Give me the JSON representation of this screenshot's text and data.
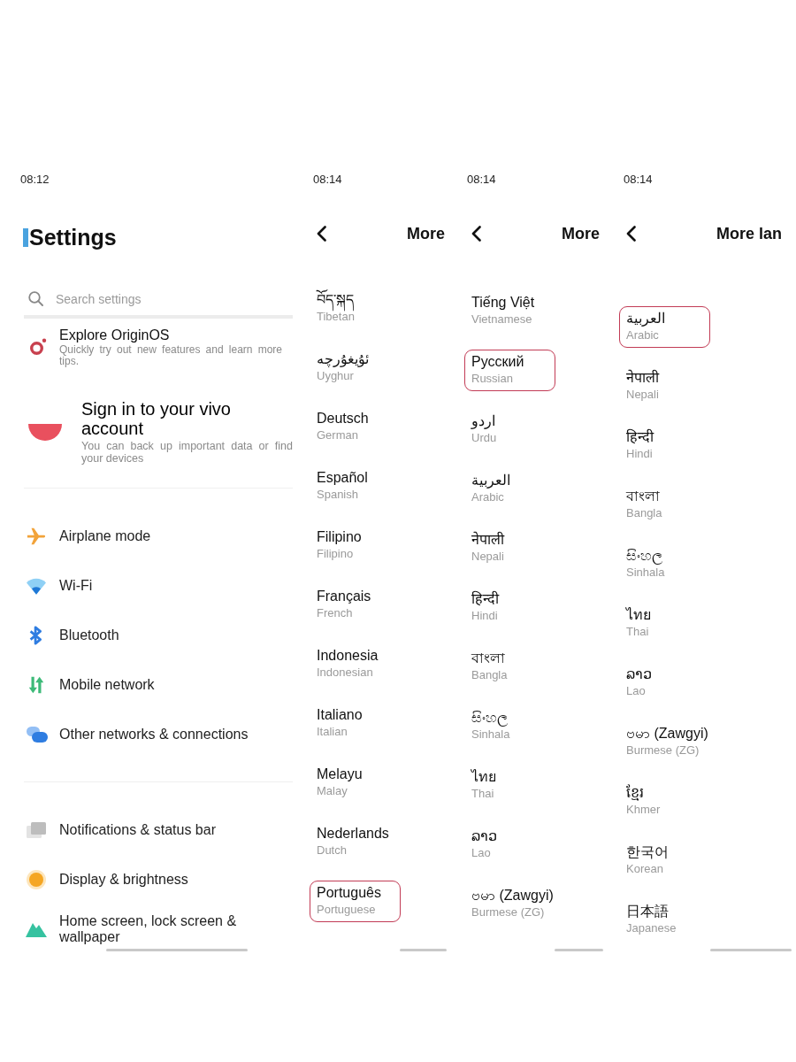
{
  "panels": [
    {
      "kind": "settings",
      "status_time": "08:12",
      "title": "Settings",
      "search": {
        "placeholder": "Search settings"
      },
      "sections": [
        {
          "items": [
            {
              "kind": "feature",
              "title": "Explore OriginOS",
              "subtitle": "Quickly try out new features and learn more tips."
            },
            {
              "kind": "account",
              "title": "Sign in to your vivo account",
              "subtitle": "You can back up important data or find your devices"
            }
          ]
        },
        {
          "items": [
            {
              "kind": "entry",
              "title": "Airplane mode"
            },
            {
              "kind": "entry",
              "title": "Wi-Fi"
            },
            {
              "kind": "entry",
              "title": "Bluetooth"
            },
            {
              "kind": "entry",
              "title": "Mobile network"
            },
            {
              "kind": "entry",
              "title": "Other networks & connections"
            }
          ]
        },
        {
          "items": [
            {
              "kind": "entry",
              "title": "Notifications & status bar"
            },
            {
              "kind": "entry",
              "title": "Display & brightness"
            },
            {
              "kind": "entry",
              "title": "Home screen, lock screen & wallpaper"
            }
          ]
        }
      ]
    },
    {
      "kind": "languages",
      "status_time": "08:14",
      "title": "More",
      "languages": [
        {
          "name": "བོད་སྐད",
          "english": "Tibetan",
          "highlighted": false
        },
        {
          "name": "ئۇيغۇرچە",
          "english": "Uyghur",
          "highlighted": false
        },
        {
          "name": "Deutsch",
          "english": "German",
          "highlighted": false
        },
        {
          "name": "Español",
          "english": "Spanish",
          "highlighted": false
        },
        {
          "name": "Filipino",
          "english": "Filipino",
          "highlighted": false
        },
        {
          "name": "Français",
          "english": "French",
          "highlighted": false
        },
        {
          "name": "Indonesia",
          "english": "Indonesian",
          "highlighted": false
        },
        {
          "name": "Italiano",
          "english": "Italian",
          "highlighted": false
        },
        {
          "name": "Melayu",
          "english": "Malay",
          "highlighted": false
        },
        {
          "name": "Nederlands",
          "english": "Dutch",
          "highlighted": false
        },
        {
          "name": "Português",
          "english": "Portuguese",
          "highlighted": true
        }
      ]
    },
    {
      "kind": "languages",
      "status_time": "08:14",
      "title": "More",
      "languages": [
        {
          "name": "Tiếng Việt",
          "english": "Vietnamese",
          "highlighted": false
        },
        {
          "name": "Русский",
          "english": "Russian",
          "highlighted": true
        },
        {
          "name": "اردو",
          "english": "Urdu",
          "highlighted": false
        },
        {
          "name": "العربية",
          "english": "Arabic",
          "highlighted": false
        },
        {
          "name": "नेपाली",
          "english": "Nepali",
          "highlighted": false
        },
        {
          "name": "हिन्दी",
          "english": "Hindi",
          "highlighted": false
        },
        {
          "name": "বাংলা",
          "english": "Bangla",
          "highlighted": false
        },
        {
          "name": "සිංහල",
          "english": "Sinhala",
          "highlighted": false
        },
        {
          "name": "ไทย",
          "english": "Thai",
          "highlighted": false
        },
        {
          "name": "ລາວ",
          "english": "Lao",
          "highlighted": false
        },
        {
          "name": "ဗမာ (Zawgyi)",
          "english": "Burmese (ZG)",
          "highlighted": false
        }
      ]
    },
    {
      "kind": "languages",
      "status_time": "08:14",
      "title": "More lan",
      "languages": [
        {
          "name": "العربية",
          "english": "Arabic",
          "highlighted": true
        },
        {
          "name": "नेपाली",
          "english": "Nepali",
          "highlighted": false
        },
        {
          "name": "हिन्दी",
          "english": "Hindi",
          "highlighted": false
        },
        {
          "name": "বাংলা",
          "english": "Bangla",
          "highlighted": false
        },
        {
          "name": "සිංහල",
          "english": "Sinhala",
          "highlighted": false
        },
        {
          "name": "ไทย",
          "english": "Thai",
          "highlighted": false
        },
        {
          "name": "ລາວ",
          "english": "Lao",
          "highlighted": false
        },
        {
          "name": "ဗမာ (Zawgyi)",
          "english": "Burmese (ZG)",
          "highlighted": false
        },
        {
          "name": "ខ្មែរ",
          "english": "Khmer",
          "highlighted": false
        },
        {
          "name": "한국어",
          "english": "Korean",
          "highlighted": false
        },
        {
          "name": "日本語",
          "english": "Japanese",
          "highlighted": false
        }
      ]
    }
  ]
}
